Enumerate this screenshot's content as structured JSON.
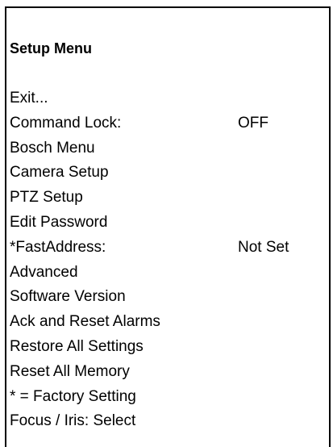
{
  "menu": {
    "title": "Setup Menu",
    "items": [
      {
        "label": "Exit...",
        "value": ""
      },
      {
        "label": "Command Lock:",
        "value": "OFF"
      },
      {
        "label": "Bosch Menu",
        "value": ""
      },
      {
        "label": "Camera Setup",
        "value": ""
      },
      {
        "label": "PTZ Setup",
        "value": ""
      },
      {
        "label": "Edit Password",
        "value": ""
      },
      {
        "label": "*FastAddress:",
        "value": "Not Set"
      },
      {
        "label": "Advanced",
        "value": ""
      },
      {
        "label": "Software Version",
        "value": ""
      },
      {
        "label": "Ack and Reset Alarms",
        "value": ""
      },
      {
        "label": "Restore All Settings",
        "value": ""
      },
      {
        "label": "Reset All Memory",
        "value": ""
      },
      {
        "label": "* = Factory Setting",
        "value": ""
      },
      {
        "label": "Focus / Iris: Select",
        "value": ""
      }
    ]
  }
}
